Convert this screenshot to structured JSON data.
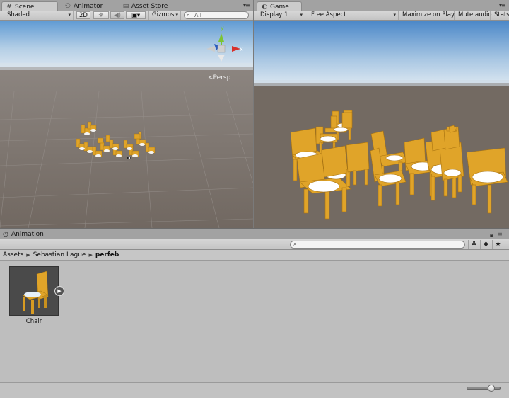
{
  "tabs": {
    "scene": "Scene",
    "animator": "Animator",
    "asset_store": "Asset Store",
    "game": "Game"
  },
  "scene_toolbar": {
    "shading": "Shaded",
    "mode_2d": "2D",
    "gizmos": "Gizmos",
    "search_placeholder": "All"
  },
  "scene_view": {
    "projection_label": "Persp",
    "gizmo_axes": {
      "y": "y",
      "x": "x"
    }
  },
  "game_toolbar": {
    "display": "Display 1",
    "aspect": "Free Aspect",
    "maximize_on_play": "Maximize on Play",
    "mute_audio": "Mute audio",
    "stats": "Stats"
  },
  "bottom_panel": {
    "tab_label": "Animation",
    "breadcrumb": [
      "Assets",
      "Sebastian Lague",
      "perfeb"
    ],
    "assets": [
      {
        "name": "Chair",
        "icon": "chair-prefab-thumbnail"
      }
    ],
    "zoom_level": 0.8
  },
  "colors": {
    "chair": "#e0a429",
    "seat_cushion": "#ffffff",
    "ground": "#736a62",
    "sky_top": "#4a87c8",
    "sky_horizon": "#cfe0ef",
    "gizmo_y": "#7cc432",
    "gizmo_x": "#d8302a",
    "gizmo_z": "#2b5bbf"
  }
}
